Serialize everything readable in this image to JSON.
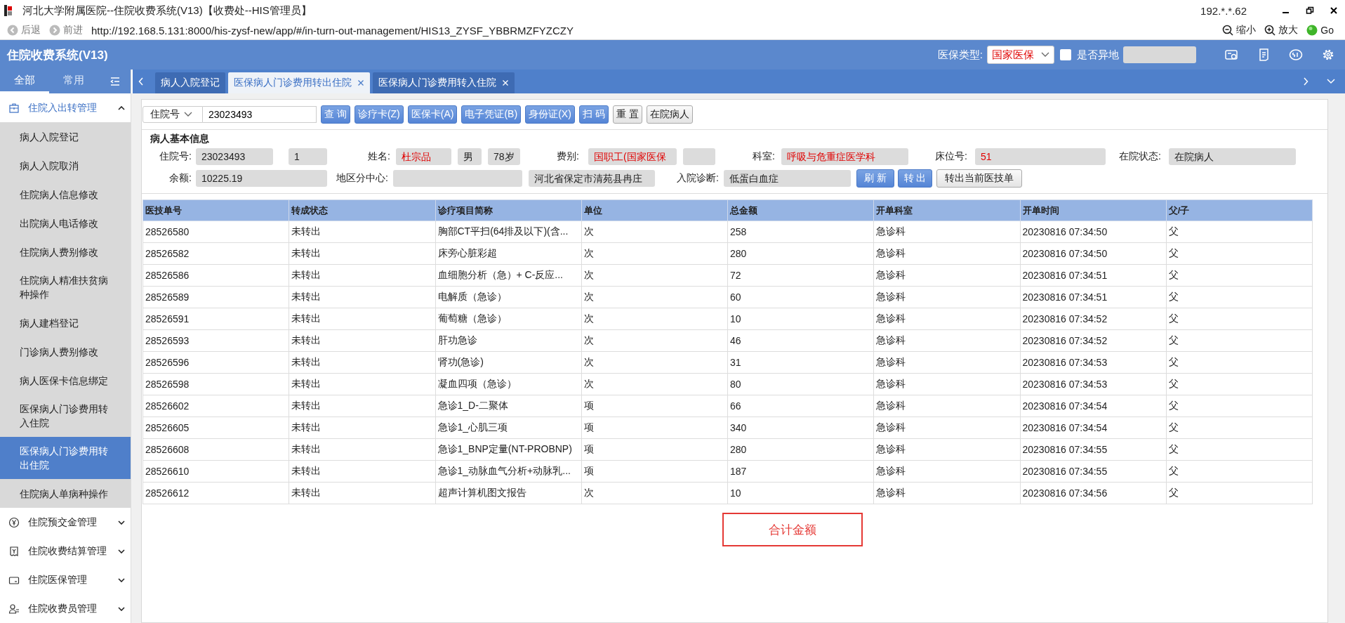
{
  "window": {
    "title": "河北大学附属医院--住院收费系统(V13)【收费处--HIS管理员】",
    "host": "192.*.*.62"
  },
  "browser": {
    "back": "后退",
    "forward": "前进",
    "url": "http://192.168.5.131:8000/his-zysf-new/app/#/in-turn-out-management/HIS13_ZYSF_YBBRMZFYZCZY",
    "zoom_out": "缩小",
    "zoom_in": "放大",
    "go": "Go"
  },
  "app": {
    "title": "住院收费系统(V13)",
    "insurance_type_label": "医保类型:",
    "insurance_type": "国家医保",
    "remote_label": "是否异地",
    "remote_checked": false
  },
  "sidebar": {
    "tabs": [
      {
        "label": "全部",
        "selected": true
      },
      {
        "label": "常用",
        "selected": false
      }
    ],
    "groups": [
      {
        "label": "住院入出转管理",
        "expanded": true,
        "children": [
          {
            "label": "病人入院登记",
            "selected": false
          },
          {
            "label": "病人入院取消",
            "selected": false
          },
          {
            "label": "住院病人信息修改",
            "selected": false
          },
          {
            "label": "出院病人电话修改",
            "selected": false
          },
          {
            "label": "住院病人费别修改",
            "selected": false
          },
          {
            "label": "住院病人精准扶贫病种操作",
            "selected": false
          },
          {
            "label": "病人建档登记",
            "selected": false
          },
          {
            "label": "门诊病人费别修改",
            "selected": false
          },
          {
            "label": "病人医保卡信息绑定",
            "selected": false
          },
          {
            "label": "医保病人门诊费用转入住院",
            "selected": false
          },
          {
            "label": "医保病人门诊费用转出住院",
            "selected": true
          },
          {
            "label": "住院病人单病种操作",
            "selected": false
          }
        ]
      },
      {
        "label": "住院预交金管理",
        "expanded": false
      },
      {
        "label": "住院收费结算管理",
        "expanded": false
      },
      {
        "label": "住院医保管理",
        "expanded": false
      },
      {
        "label": "住院收费员管理",
        "expanded": false
      }
    ]
  },
  "tabs": [
    {
      "label": "病人入院登记",
      "selected": false,
      "closable": false
    },
    {
      "label": "医保病人门诊费用转出住院",
      "selected": true,
      "closable": true
    },
    {
      "label": "医保病人门诊费用转入住院",
      "selected": false,
      "closable": true
    }
  ],
  "toolbar": {
    "search_type": "住院号",
    "search_value": "23023493",
    "buttons": [
      {
        "label": "查 询",
        "kind": "primary"
      },
      {
        "label": "诊疗卡(Z)",
        "kind": "primary"
      },
      {
        "label": "医保卡(A)",
        "kind": "primary"
      },
      {
        "label": "电子凭证(B)",
        "kind": "primary"
      },
      {
        "label": "身份证(X)",
        "kind": "primary"
      },
      {
        "label": "扫 码",
        "kind": "primary"
      },
      {
        "label": "重 置",
        "kind": "default"
      },
      {
        "label": "在院病人",
        "kind": "default"
      }
    ]
  },
  "patient_info": {
    "title": "病人基本信息",
    "rows": [
      {
        "items": [
          {
            "kind": "label",
            "text": "住院号:"
          },
          {
            "kind": "field",
            "value": "23023493",
            "alert": false
          },
          {
            "kind": "field",
            "value": "1",
            "alert": false
          },
          {
            "kind": "label",
            "text": "姓名:"
          },
          {
            "kind": "field",
            "value": "杜宗品",
            "alert": true
          },
          {
            "kind": "field",
            "value": "男",
            "alert": false
          },
          {
            "kind": "field",
            "value": "78岁",
            "alert": false
          },
          {
            "kind": "label",
            "text": "费别:"
          },
          {
            "kind": "field",
            "value": "国职工(国家医保",
            "alert": true
          },
          {
            "kind": "field"
          },
          {
            "kind": "label",
            "text": "科室:"
          },
          {
            "kind": "field",
            "value": "呼吸与危重症医学科",
            "alert": true
          },
          {
            "kind": "label",
            "text": "床位号:"
          },
          {
            "kind": "field",
            "value": "51",
            "alert": true
          },
          {
            "kind": "label",
            "text": "在院状态:"
          },
          {
            "kind": "field",
            "value": "在院病人",
            "alert": false
          }
        ]
      },
      {
        "items": [
          {
            "kind": "label",
            "text": "余额:"
          },
          {
            "kind": "field",
            "value": "10225.19",
            "alert": false
          },
          {
            "kind": "label",
            "text": "地区分中心:"
          },
          {
            "kind": "field"
          },
          {
            "kind": "field",
            "value": "河北省保定市清苑县冉庄",
            "alert": false
          },
          {
            "kind": "label",
            "text": "入院诊断:"
          },
          {
            "kind": "field",
            "value": "低蛋白血症",
            "alert": false
          },
          {
            "kind": "button",
            "text": "刷 新",
            "primary": true
          },
          {
            "kind": "button",
            "text": "转 出",
            "primary": true
          },
          {
            "kind": "button",
            "text": "转出当前医技单",
            "primary": false
          }
        ]
      }
    ]
  },
  "table": {
    "columns": [
      "医技单号",
      "转成状态",
      "诊疗项目简称",
      "单位",
      "总金额",
      "开单科室",
      "开单时间",
      "父/子"
    ],
    "rows": [
      [
        "28526580",
        "未转出",
        "胸部CT平扫(64排及以下)(含...",
        "次",
        "258",
        "急诊科",
        "20230816 07:34:50",
        "父"
      ],
      [
        "28526582",
        "未转出",
        "床旁心脏彩超",
        "次",
        "280",
        "急诊科",
        "20230816 07:34:50",
        "父"
      ],
      [
        "28526586",
        "未转出",
        "血细胞分析（急）+ C-反应...",
        "次",
        "72",
        "急诊科",
        "20230816 07:34:51",
        "父"
      ],
      [
        "28526589",
        "未转出",
        "电解质（急诊）",
        "次",
        "60",
        "急诊科",
        "20230816 07:34:51",
        "父"
      ],
      [
        "28526591",
        "未转出",
        "葡萄糖（急诊）",
        "次",
        "10",
        "急诊科",
        "20230816 07:34:52",
        "父"
      ],
      [
        "28526593",
        "未转出",
        "肝功急诊",
        "次",
        "46",
        "急诊科",
        "20230816 07:34:52",
        "父"
      ],
      [
        "28526596",
        "未转出",
        "肾功(急诊)",
        "次",
        "31",
        "急诊科",
        "20230816 07:34:53",
        "父"
      ],
      [
        "28526598",
        "未转出",
        "凝血四项（急诊）",
        "次",
        "80",
        "急诊科",
        "20230816 07:34:53",
        "父"
      ],
      [
        "28526602",
        "未转出",
        "急诊1_D-二聚体",
        "项",
        "66",
        "急诊科",
        "20230816 07:34:54",
        "父"
      ],
      [
        "28526605",
        "未转出",
        "急诊1_心肌三项",
        "项",
        "340",
        "急诊科",
        "20230816 07:34:54",
        "父"
      ],
      [
        "28526608",
        "未转出",
        "急诊1_BNP定量(NT-PROBNP)",
        "项",
        "280",
        "急诊科",
        "20230816 07:34:55",
        "父"
      ],
      [
        "28526610",
        "未转出",
        "急诊1_动脉血气分析+动脉乳...",
        "项",
        "187",
        "急诊科",
        "20230816 07:34:55",
        "父"
      ],
      [
        "28526612",
        "未转出",
        "超声计算机图文报告",
        "次",
        "10",
        "急诊科",
        "20230816 07:34:56",
        "父"
      ]
    ]
  },
  "total_label": "合计金额"
}
